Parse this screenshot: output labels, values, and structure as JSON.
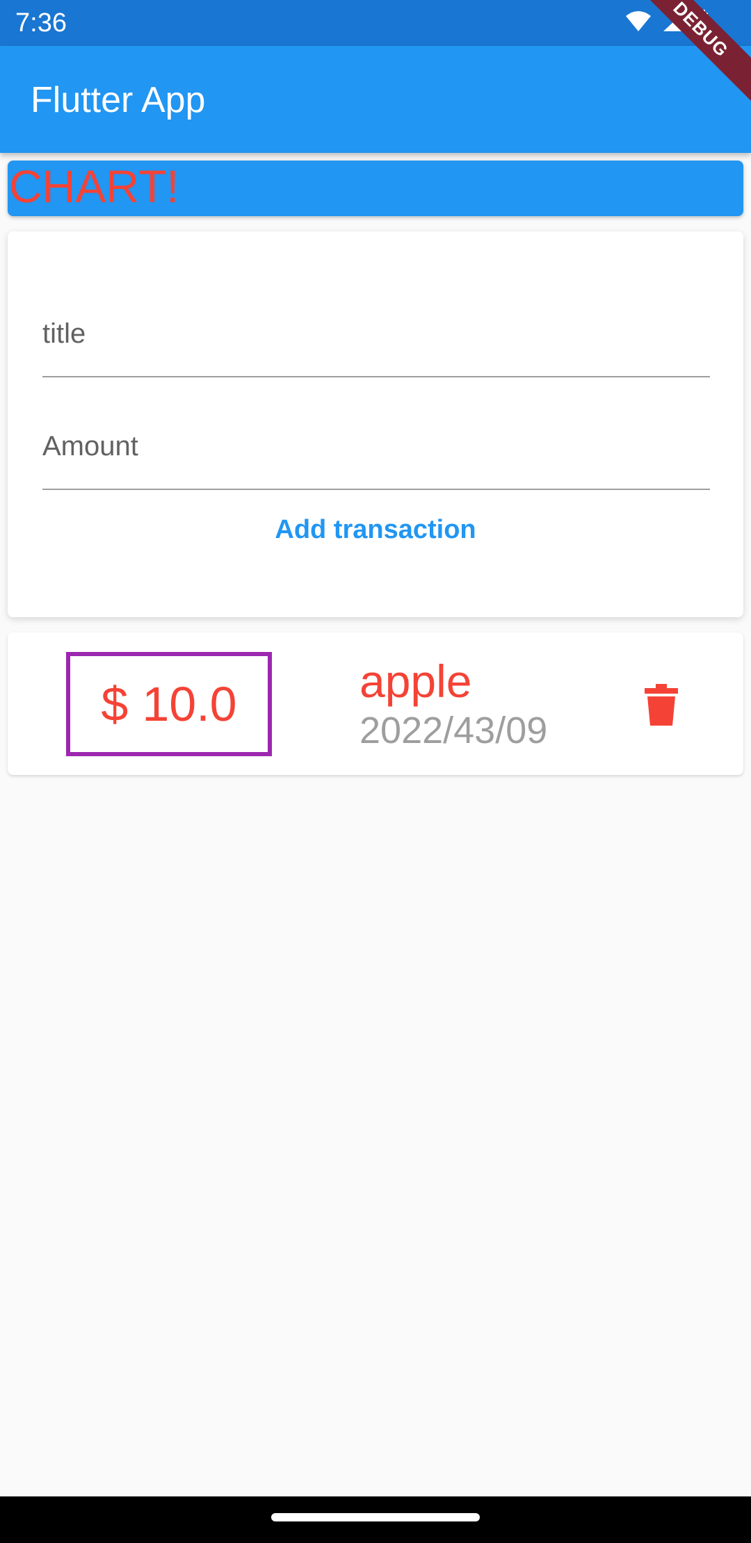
{
  "status_bar": {
    "time": "7:36",
    "icons": [
      "wifi-icon",
      "signal-icon",
      "battery-icon"
    ]
  },
  "app_bar": {
    "title": "Flutter App",
    "debug_banner": "DEBUG"
  },
  "chart": {
    "label": "CHART!"
  },
  "form": {
    "title_placeholder": "title",
    "title_value": "",
    "amount_placeholder": "Amount",
    "amount_value": "",
    "add_button_label": "Add transaction"
  },
  "transactions": [
    {
      "currency": "$",
      "amount": "10.0",
      "title": "apple",
      "date": "2022/43/09",
      "delete_icon": "trash-icon"
    }
  ],
  "colors": {
    "primary": "#2196f3",
    "primary_dark": "#1976d2",
    "accent_red": "#f44336",
    "amount_border": "#9c27b0",
    "date_grey": "#9e9e9e",
    "background": "#fafafa"
  }
}
